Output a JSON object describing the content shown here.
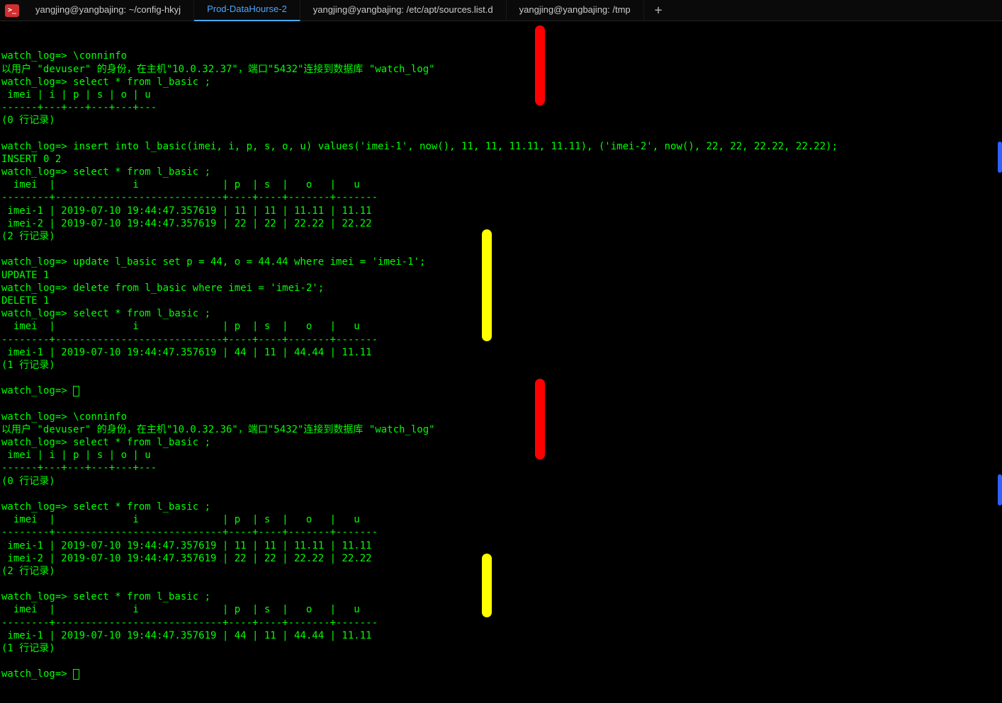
{
  "tabs": {
    "items": [
      {
        "label": "yangjing@yangbajing: ~/config-hkyj",
        "active": false
      },
      {
        "label": "Prod-DataHourse-2",
        "active": true
      },
      {
        "label": "yangjing@yangbajing: /etc/apt/sources.list.d",
        "active": false
      },
      {
        "label": "yangjing@yangbajing: /tmp",
        "active": false
      }
    ],
    "addLabel": "+"
  },
  "terminal": {
    "lines": [
      "watch_log=> \\conninfo",
      "以用户 \"devuser\" 的身份，在主机\"10.0.32.37\"，端口\"5432\"连接到数据库 \"watch_log\"",
      "watch_log=> select * from l_basic ;",
      " imei | i | p | s | o | u ",
      "------+---+---+---+---+---",
      "(0 行记录)",
      "",
      "watch_log=> insert into l_basic(imei, i, p, s, o, u) values('imei-1', now(), 11, 11, 11.11, 11.11), ('imei-2', now(), 22, 22, 22.22, 22.22);",
      "INSERT 0 2",
      "watch_log=> select * from l_basic ;",
      "  imei  |             i              | p  | s  |   o   |   u   ",
      "--------+----------------------------+----+----+-------+-------",
      " imei-1 | 2019-07-10 19:44:47.357619 | 11 | 11 | 11.11 | 11.11",
      " imei-2 | 2019-07-10 19:44:47.357619 | 22 | 22 | 22.22 | 22.22",
      "(2 行记录)",
      "",
      "watch_log=> update l_basic set p = 44, o = 44.44 where imei = 'imei-1';",
      "UPDATE 1",
      "watch_log=> delete from l_basic where imei = 'imei-2';",
      "DELETE 1",
      "watch_log=> select * from l_basic ;",
      "  imei  |             i              | p  | s  |   o   |   u   ",
      "--------+----------------------------+----+----+-------+-------",
      " imei-1 | 2019-07-10 19:44:47.357619 | 44 | 11 | 44.44 | 11.11",
      "(1 行记录)",
      "",
      "watch_log=> ▯",
      "",
      "watch_log=> \\conninfo",
      "以用户 \"devuser\" 的身份，在主机\"10.0.32.36\"，端口\"5432\"连接到数据库 \"watch_log\"",
      "watch_log=> select * from l_basic ;",
      " imei | i | p | s | o | u ",
      "------+---+---+---+---+---",
      "(0 行记录)",
      "",
      "watch_log=> select * from l_basic ;",
      "  imei  |             i              | p  | s  |   o   |   u   ",
      "--------+----------------------------+----+----+-------+-------",
      " imei-1 | 2019-07-10 19:44:47.357619 | 11 | 11 | 11.11 | 11.11",
      " imei-2 | 2019-07-10 19:44:47.357619 | 22 | 22 | 22.22 | 22.22",
      "(2 行记录)",
      "",
      "watch_log=> select * from l_basic ;",
      "  imei  |             i              | p  | s  |   o   |   u   ",
      "--------+----------------------------+----+----+-------+-------",
      " imei-1 | 2019-07-10 19:44:47.357619 | 44 | 11 | 44.44 | 11.11",
      "(1 行记录)",
      "",
      "watch_log=> ▯"
    ]
  }
}
